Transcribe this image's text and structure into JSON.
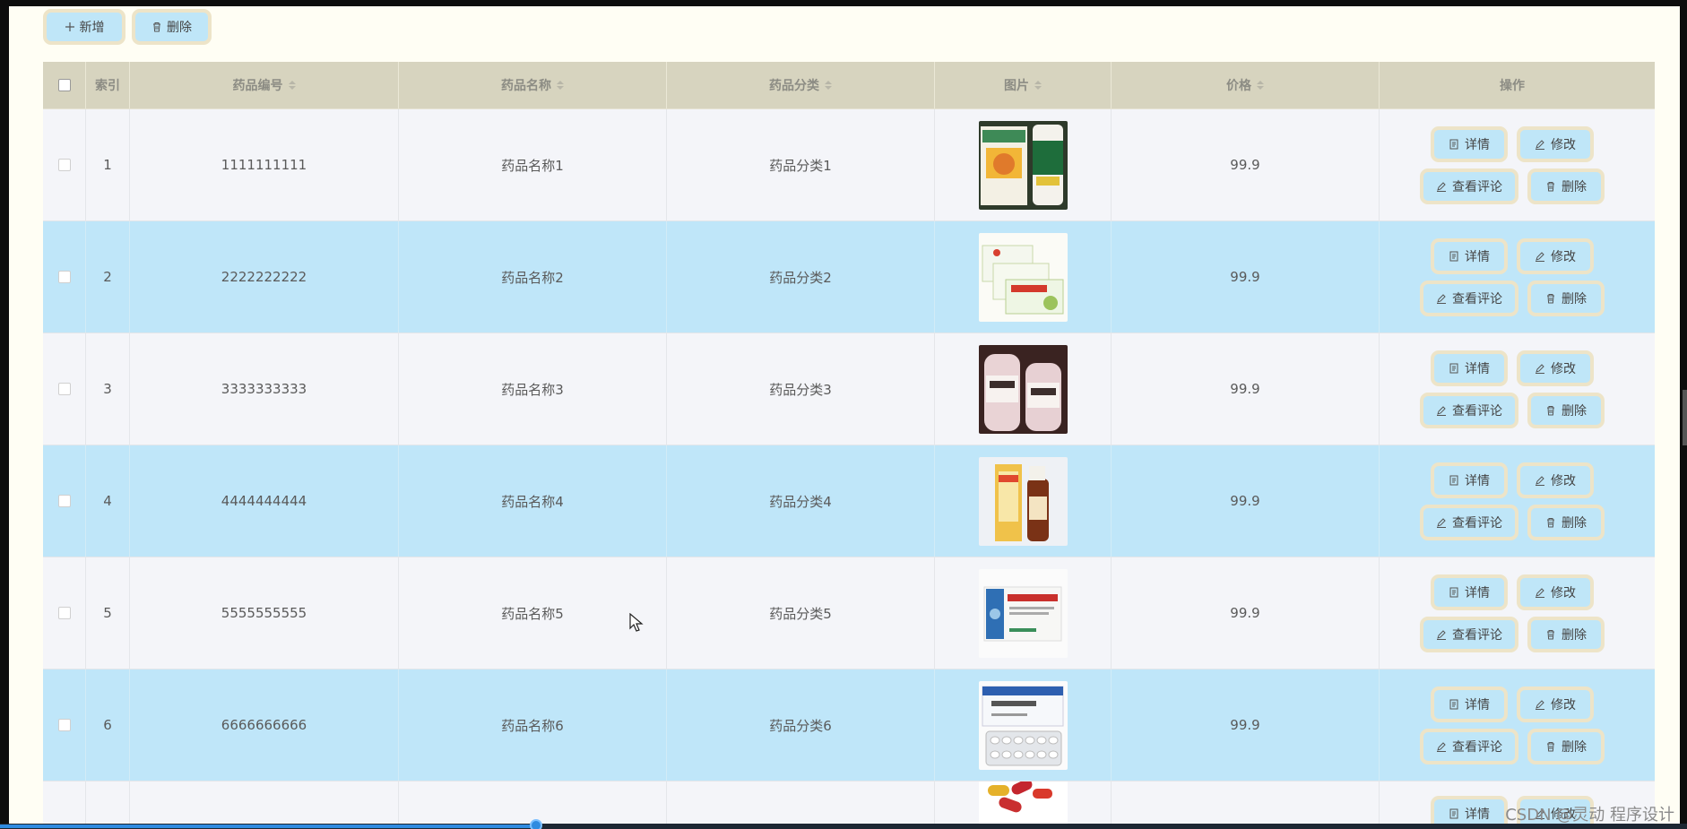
{
  "toolbar": {
    "add_label": "新增",
    "delete_label": "删除"
  },
  "table": {
    "headers": {
      "index": "索引",
      "code": "药品编号",
      "name": "药品名称",
      "category": "药品分类",
      "image": "图片",
      "price": "价格",
      "actions": "操作"
    },
    "rows": [
      {
        "index": "1",
        "code": "1111111111",
        "name": "药品名称1",
        "category": "药品分类1",
        "price": "99.9"
      },
      {
        "index": "2",
        "code": "2222222222",
        "name": "药品名称2",
        "category": "药品分类2",
        "price": "99.9"
      },
      {
        "index": "3",
        "code": "3333333333",
        "name": "药品名称3",
        "category": "药品分类3",
        "price": "99.9"
      },
      {
        "index": "4",
        "code": "4444444444",
        "name": "药品名称4",
        "category": "药品分类4",
        "price": "99.9"
      },
      {
        "index": "5",
        "code": "5555555555",
        "name": "药品名称5",
        "category": "药品分类5",
        "price": "99.9"
      },
      {
        "index": "6",
        "code": "6666666666",
        "name": "药品名称6",
        "category": "药品分类6",
        "price": "99.9"
      }
    ]
  },
  "actions": {
    "detail": "详情",
    "edit": "修改",
    "review": "查看评论",
    "remove": "删除"
  },
  "icons": {
    "add": "plus-icon",
    "delete": "trash-icon",
    "detail": "document-icon",
    "edit": "pencil-icon",
    "sort": "sort-caret-icon"
  },
  "colors": {
    "header_bg": "#d7d4bf",
    "row_odd": "#f4f5f9",
    "row_even": "#bfe6f9",
    "button_bg": "#bfe6f8",
    "button_border": "#ede4c8",
    "page_bg": "#fffef4"
  },
  "watermark": "CSDN @灵动 程序设计"
}
